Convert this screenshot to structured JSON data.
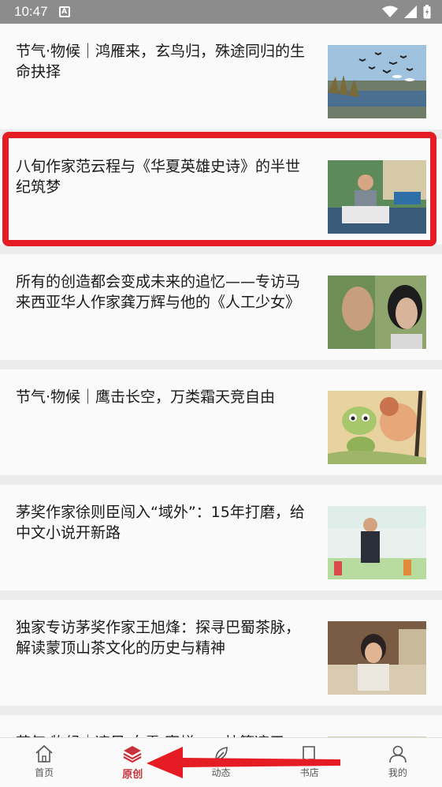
{
  "status": {
    "time": "10:47",
    "notif_glyph": "A"
  },
  "articles": [
    {
      "title": "节气·物候｜鸿雁来，玄鸟归，殊途同归的生命抉择"
    },
    {
      "title": "八旬作家范云程与《华夏英雄史诗》的半世纪筑梦"
    },
    {
      "title": "所有的创造都会变成未来的追忆——专访马来西亚华人作家龚万辉与他的《人工少女》"
    },
    {
      "title": "节气·物候｜鹰击长空，万类霜天竞自由"
    },
    {
      "title": "茅奖作家徐则臣闯入“域外”：15年打磨，给中文小说开新路"
    },
    {
      "title": "独家专访茅奖作家王旭烽：探寻巴蜀茶脉，解读蒙顶山茶文化的历史与精神"
    },
    {
      "title": "节气·物候｜凉风·白露·寒蝉，一枕簟凉于"
    }
  ],
  "tabs": [
    {
      "label": "首页",
      "icon": "home-icon"
    },
    {
      "label": "原创",
      "icon": "layers-icon"
    },
    {
      "label": "动态",
      "icon": "leaf-icon"
    },
    {
      "label": "书店",
      "icon": "book-icon"
    },
    {
      "label": "我的",
      "icon": "user-icon"
    }
  ],
  "colors": {
    "accent": "#c8323a",
    "highlight": "#e51c23",
    "status_bar": "#8c8c8c"
  }
}
